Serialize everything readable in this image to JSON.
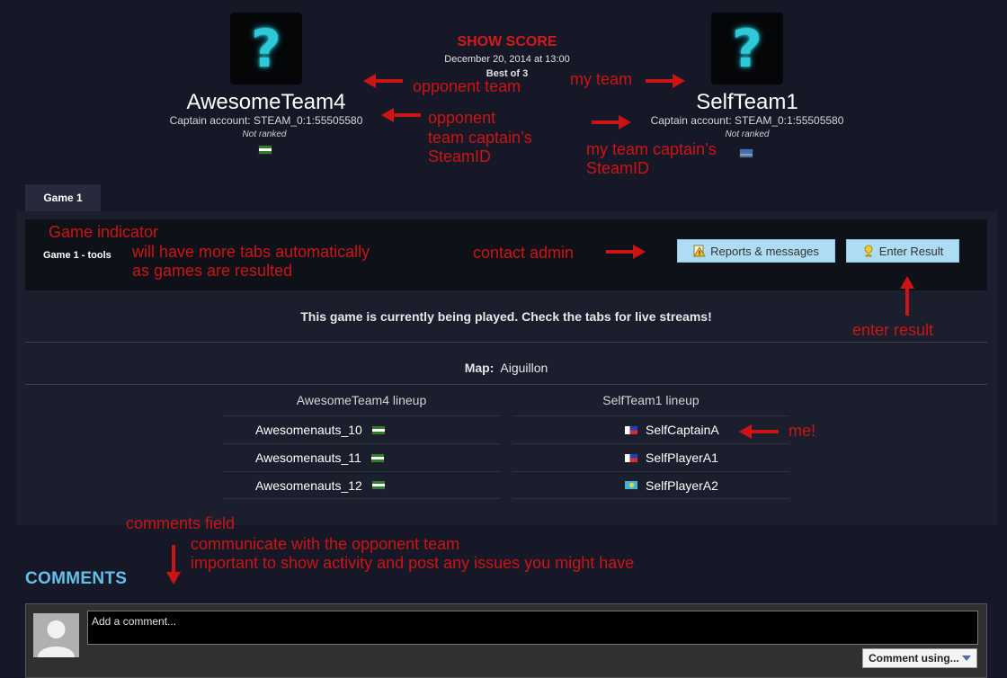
{
  "match": {
    "title": "SHOW SCORE",
    "date": "December 20, 2014 at 13:00",
    "best_of": "Best of 3"
  },
  "team_left": {
    "logo_glyph": "?",
    "name": "AwesomeTeam4",
    "captain": "Captain account: STEAM_0:1:55505580",
    "rank": "Not ranked",
    "flag": "flag-icon-green-white"
  },
  "team_right": {
    "logo_glyph": "?",
    "name": "SelfTeam1",
    "captain": "Captain account: STEAM_0:1:55505580",
    "rank": "Not ranked",
    "flag": "flag-icon-aruba"
  },
  "annotations": {
    "opponent_team": "opponent team",
    "my_team": "my team",
    "opp_captain_1": "opponent",
    "opp_captain_2": "team captain’s",
    "opp_captain_3": "SteamID",
    "my_captain_1": "my team captain’s",
    "my_captain_2": "SteamID",
    "game_indicator": "Game indicator",
    "more_tabs_1": "will have more tabs automatically",
    "more_tabs_2": "as games are resulted",
    "contact_admin": "contact admin",
    "enter_result": "enter result",
    "me": "me!",
    "comments_field": "comments field",
    "communicate_1": "communicate with the opponent team",
    "communicate_2": "important to show activity and post any issues you might have"
  },
  "tabs": [
    {
      "label": "Game 1"
    }
  ],
  "game": {
    "tools_title": "Game 1 - tools",
    "reports_button": "Reports & messages",
    "enter_result_button": "Enter Result",
    "status": "This game is currently being played. Check the tabs for live streams!",
    "map_label": "Map:",
    "map_value": "Aiguillon"
  },
  "lineups": {
    "left_header": "AwesomeTeam4 lineup",
    "right_header": "SelfTeam1 lineup",
    "left_players": [
      {
        "name": "Awesomenauts_10",
        "flag": "flag-icon-green-white"
      },
      {
        "name": "Awesomenauts_11",
        "flag": "flag-icon-green-white"
      },
      {
        "name": "Awesomenauts_12",
        "flag": "flag-icon-green-white"
      }
    ],
    "right_players": [
      {
        "name": "SelfCaptainA",
        "flag": "flag-icon-philippines"
      },
      {
        "name": "SelfPlayerA1",
        "flag": "flag-icon-philippines"
      },
      {
        "name": "SelfPlayerA2",
        "flag": "flag-icon-kazakhstan"
      }
    ]
  },
  "comments": {
    "title": "COMMENTS",
    "placeholder": "Add a comment...",
    "comment_using": "Comment using...",
    "avatar_icon": "default-avatar-icon"
  },
  "colors": {
    "background": "#161827",
    "annotation_red": "#cc1414",
    "accent_blue": "#62c2ee",
    "button_blue": "#aedcf2"
  }
}
